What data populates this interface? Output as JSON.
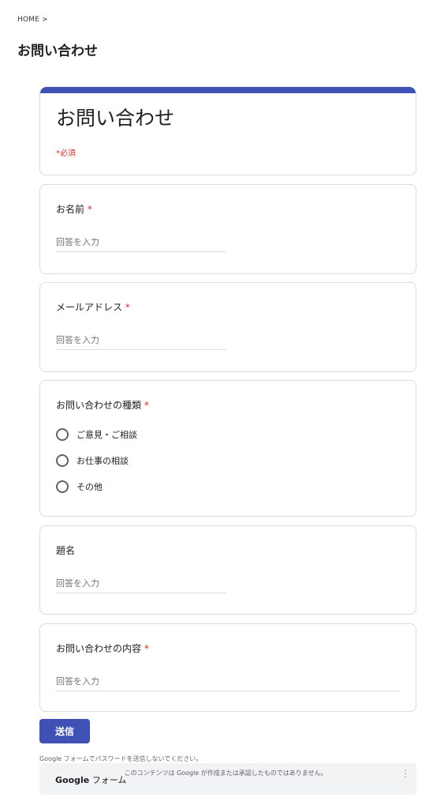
{
  "breadcrumb": "HOME >",
  "page_title": "お問い合わせ",
  "form": {
    "title": "お問い合わせ",
    "required_note": "*必須",
    "questions": {
      "name": {
        "label": "お名前",
        "required_mark": "*",
        "placeholder": "回答を入力"
      },
      "email": {
        "label": "メールアドレス",
        "required_mark": "*",
        "placeholder": "回答を入力"
      },
      "type": {
        "label": "お問い合わせの種類",
        "required_mark": "*",
        "options": [
          "ご意見・ご相談",
          "お仕事の相談",
          "その他"
        ]
      },
      "subject": {
        "label": "題名",
        "placeholder": "回答を入力"
      },
      "content": {
        "label": "お問い合わせの内容",
        "required_mark": "*",
        "placeholder": "回答を入力"
      }
    },
    "submit_label": "送信",
    "password_notice": "Google フォームでパスワードを送信しないでください。"
  },
  "footer": {
    "brand_bold": "Google",
    "brand_rest": " フォーム",
    "disclaimer": "このコンテンツは Google が作成または承認したものではありません。",
    "menu_icon": "more-vert-icon"
  },
  "colors": {
    "accent": "#3f51b5",
    "required": "#d93025",
    "border": "#dadce0"
  }
}
